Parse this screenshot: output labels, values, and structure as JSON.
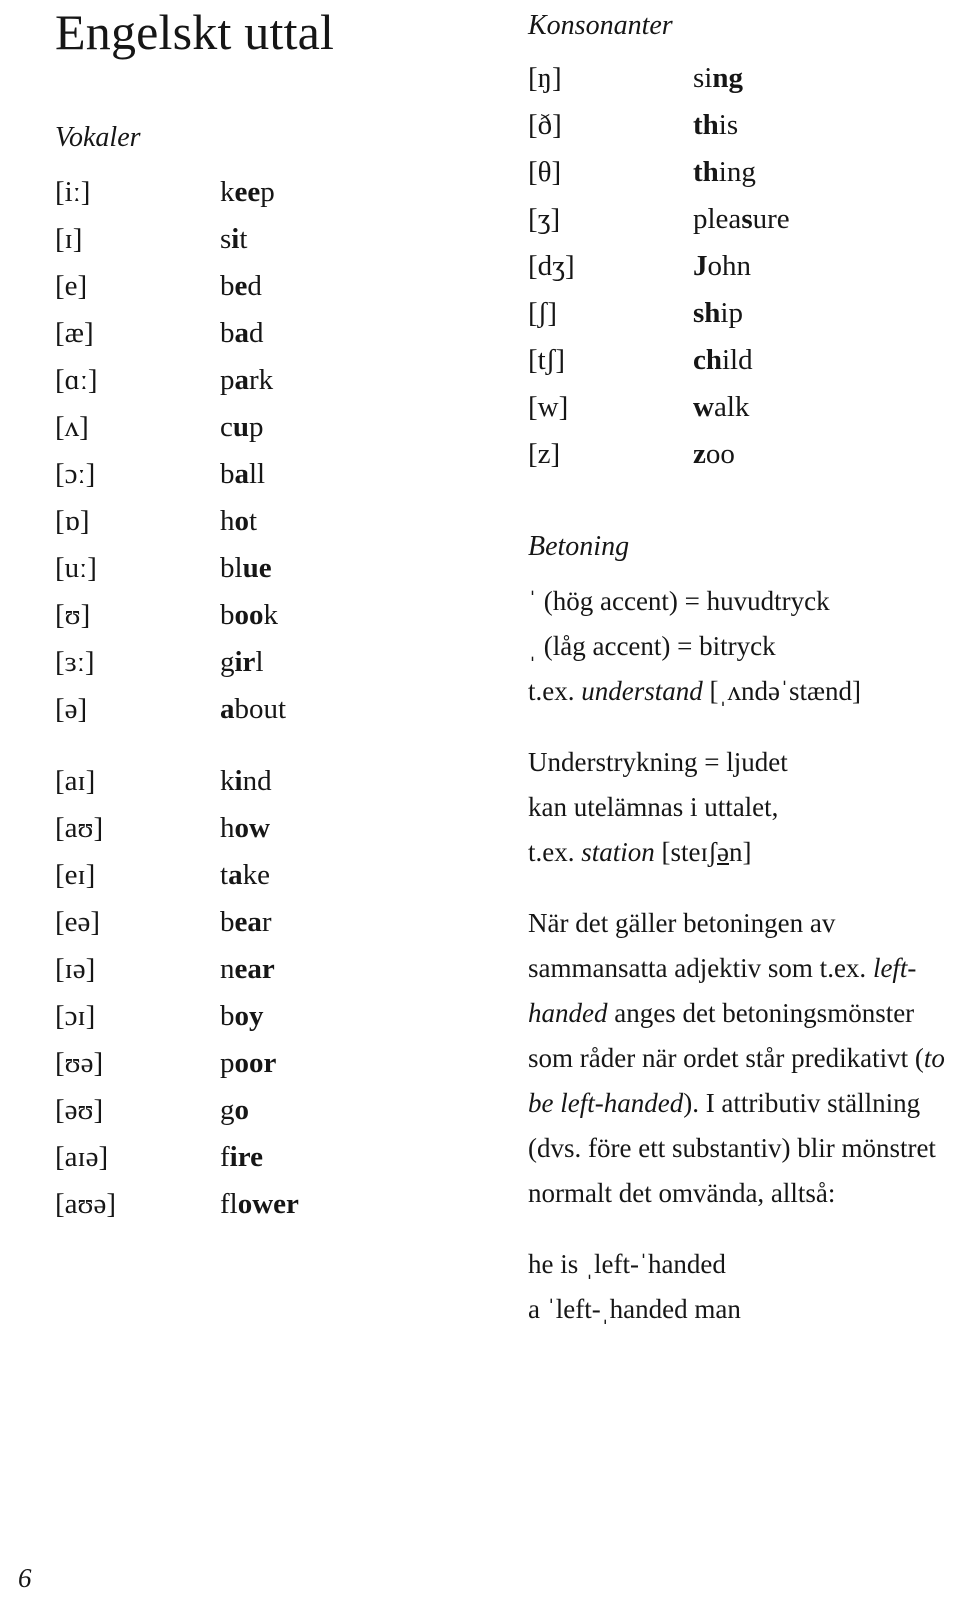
{
  "page": {
    "title": "Engelskt uttal",
    "number": "6"
  },
  "vowels": {
    "heading": "Vokaler",
    "monophthongs": [
      {
        "ipa": "[iː]",
        "word_pre": "k",
        "word_bold": "ee",
        "word_post": "p",
        "word": "keep"
      },
      {
        "ipa": "[ɪ]",
        "word_pre": "s",
        "word_bold": "i",
        "word_post": "t",
        "word": "sit"
      },
      {
        "ipa": "[e]",
        "word_pre": "b",
        "word_bold": "e",
        "word_post": "d",
        "word": "bed"
      },
      {
        "ipa": "[æ]",
        "word_pre": "b",
        "word_bold": "a",
        "word_post": "d",
        "word": "bad"
      },
      {
        "ipa": "[ɑː]",
        "word_pre": "p",
        "word_bold": "a",
        "word_post": "rk",
        "word": "park"
      },
      {
        "ipa": "[ʌ]",
        "word_pre": "c",
        "word_bold": "u",
        "word_post": "p",
        "word": "cup"
      },
      {
        "ipa": "[ɔː]",
        "word_pre": "b",
        "word_bold": "a",
        "word_post": "ll",
        "word": "ball"
      },
      {
        "ipa": "[ɒ]",
        "word_pre": "h",
        "word_bold": "o",
        "word_post": "t",
        "word": "hot"
      },
      {
        "ipa": "[uː]",
        "word_pre": "bl",
        "word_bold": "ue",
        "word_post": "",
        "word": "blue"
      },
      {
        "ipa": "[ʊ]",
        "word_pre": "b",
        "word_bold": "oo",
        "word_post": "k",
        "word": "book"
      },
      {
        "ipa": "[ɜː]",
        "word_pre": "g",
        "word_bold": "ir",
        "word_post": "l",
        "word": "girl"
      },
      {
        "ipa": "[ə]",
        "word_pre": "",
        "word_bold": "a",
        "word_post": "bout",
        "word": "about"
      }
    ],
    "diphthongs": [
      {
        "ipa": "[aɪ]",
        "word_pre": "k",
        "word_bold": "i",
        "word_post": "nd",
        "word": "kind"
      },
      {
        "ipa": "[aʊ]",
        "word_pre": "h",
        "word_bold": "ow",
        "word_post": "",
        "word": "how"
      },
      {
        "ipa": "[eɪ]",
        "word_pre": "t",
        "word_bold": "a",
        "word_post": "ke",
        "word": "take"
      },
      {
        "ipa": "[eə]",
        "word_pre": "b",
        "word_bold": "ea",
        "word_post": "r",
        "word": "bear"
      },
      {
        "ipa": "[ɪə]",
        "word_pre": "n",
        "word_bold": "ear",
        "word_post": "",
        "word": "near"
      },
      {
        "ipa": "[ɔɪ]",
        "word_pre": "b",
        "word_bold": "oy",
        "word_post": "",
        "word": "boy"
      },
      {
        "ipa": "[ʊə]",
        "word_pre": "p",
        "word_bold": "oor",
        "word_post": "",
        "word": "poor"
      },
      {
        "ipa": "[əʊ]",
        "word_pre": "g",
        "word_bold": "o",
        "word_post": "",
        "word": "go"
      },
      {
        "ipa": "[aɪə]",
        "word_pre": "f",
        "word_bold": "ire",
        "word_post": "",
        "word": "fire"
      },
      {
        "ipa": "[aʊə]",
        "word_pre": "fl",
        "word_bold": "ower",
        "word_post": "",
        "word": "flower"
      }
    ]
  },
  "consonants": {
    "heading": "Konsonanter",
    "items": [
      {
        "ipa": "[ŋ]",
        "word_pre": "si",
        "word_bold": "ng",
        "word_post": "",
        "word": "sing"
      },
      {
        "ipa": "[ð]",
        "word_pre": "",
        "word_bold": "th",
        "word_post": "is",
        "word": "this"
      },
      {
        "ipa": "[θ]",
        "word_pre": "",
        "word_bold": "th",
        "word_post": "ing",
        "word": "thing"
      },
      {
        "ipa": "[ʒ]",
        "word_pre": "plea",
        "word_bold": "s",
        "word_post": "ure",
        "word": "pleasure"
      },
      {
        "ipa": "[dʒ]",
        "word_pre": "",
        "word_bold": "J",
        "word_post": "ohn",
        "word": "John"
      },
      {
        "ipa": "[ʃ]",
        "word_pre": "",
        "word_bold": "sh",
        "word_post": "ip",
        "word": "ship"
      },
      {
        "ipa": "[tʃ]",
        "word_pre": "",
        "word_bold": "ch",
        "word_post": "ild",
        "word": "child"
      },
      {
        "ipa": "[w]",
        "word_pre": "",
        "word_bold": "w",
        "word_post": "alk",
        "word": "walk"
      },
      {
        "ipa": "[z]",
        "word_pre": "",
        "word_bold": "z",
        "word_post": "oo",
        "word": "zoo"
      }
    ]
  },
  "stress": {
    "heading": "Betoning",
    "high_accent_mark": "ˈ",
    "high_accent_text": "(hög accent) = huvudtryck",
    "low_accent_mark": "ˌ",
    "low_accent_text": "(låg accent) = bitryck",
    "example1_prefix": "t.ex.",
    "example1_word": "understand",
    "example1_ipa": "[ˌʌndəˈstænd]",
    "underline_note_line1": "Understrykning = ljudet",
    "underline_note_line2": "kan utelämnas i uttalet,",
    "example2_prefix": "t.ex.",
    "example2_word": "station",
    "example2_ipa_pre": "[steɪʃ",
    "example2_ipa_underlined": "ə",
    "example2_ipa_post": "n]",
    "paragraph_part1": "När det gäller betoningen av sammansatta adjektiv som t.ex.",
    "paragraph_word1": "left-handed",
    "paragraph_part2": "anges det betoningsmönster som råder när ordet står predikativt (",
    "paragraph_word2": "to be left-handed",
    "paragraph_part3": "). I attributiv ställning (dvs. före ett substantiv) blir mönstret normalt det omvända, alltså:",
    "example_predicative": "he is ˌleft-ˈhanded",
    "example_attributive": "a ˈleft-ˌhanded man"
  }
}
